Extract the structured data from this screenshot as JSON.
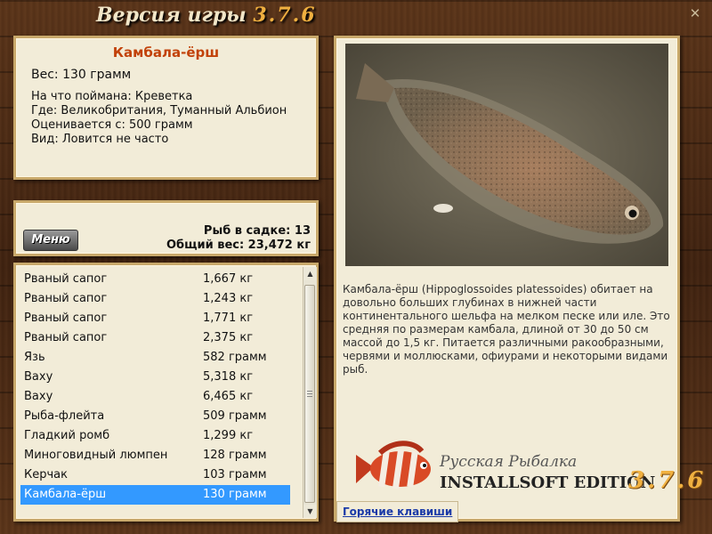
{
  "window": {
    "title": "Версия игры ",
    "version": "3.7.6"
  },
  "fish": {
    "name": "Камбала-ёрш",
    "weight": "Вес: 130 грамм",
    "bait": "На что поймана: Креветка",
    "location": "Где: Великобритания, Туманный Альбион",
    "price": "Оценивается с: 500 грамм",
    "rarity": "Вид: Ловится не часто"
  },
  "catch": {
    "menu_label": "Меню",
    "count": "Рыб в садке: 13",
    "total_weight": "Общий вес: 23,472 кг"
  },
  "list": {
    "items": [
      {
        "name": "Рваный сапог",
        "weight": "1,667 кг"
      },
      {
        "name": "Рваный сапог",
        "weight": "1,243 кг"
      },
      {
        "name": "Рваный сапог",
        "weight": "1,771 кг"
      },
      {
        "name": "Рваный сапог",
        "weight": "2,375 кг"
      },
      {
        "name": "Язь",
        "weight": "582 грамм"
      },
      {
        "name": "Ваху",
        "weight": "5,318 кг"
      },
      {
        "name": "Ваху",
        "weight": "6,465 кг"
      },
      {
        "name": "Рыба-флейта",
        "weight": "509 грамм"
      },
      {
        "name": "Гладкий ромб",
        "weight": "1,299 кг"
      },
      {
        "name": "Миноговидный люмпен",
        "weight": "128 грамм"
      },
      {
        "name": "Керчак",
        "weight": "103 грамм"
      },
      {
        "name": "Камбала-ёрш",
        "weight": "130 грамм"
      }
    ],
    "selected_index": 11
  },
  "description": "Камбала-ёрш (Hippoglossoides platessoides) обитает на довольно больших глубинах в нижней части континентального шельфа на мелком песке или иле. Это средняя по размерам камбала, длиной от 30 до 50 см массой до 1,5 кг. Питается различными ракообразными, червями и моллюсками, офиурами и некоторыми видами рыб.",
  "branding": {
    "line1": "Русская Рыбалка",
    "line2": "INSTALLSOFT EDITION",
    "version": "3.7.6"
  },
  "hotkeys_label": "Горячие клавиши",
  "icons": {
    "close": "close-icon",
    "scroll_up": "arrow-up-icon",
    "scroll_down": "arrow-down-icon",
    "brand": "fish-logo-icon"
  },
  "colors": {
    "fish_name": "#c2420a",
    "selection": "#3399ff",
    "version_accent": "#f0b040",
    "link": "#1a3aa8"
  }
}
